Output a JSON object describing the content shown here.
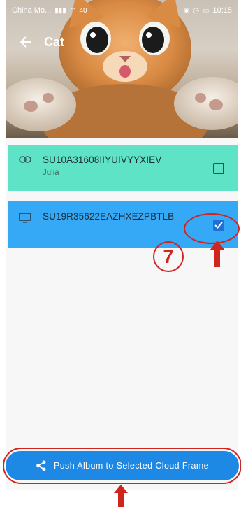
{
  "status_bar": {
    "carrier": "China Mo...",
    "time": "10:15",
    "speed": "40"
  },
  "header": {
    "title": "Cat"
  },
  "devices": [
    {
      "id": "SU10A31608IIYUIVYYXIEV",
      "name": "Julia",
      "icon": "link-icon",
      "checked": false,
      "color": "#5ee3c6"
    },
    {
      "id": "SU19R35622EAZHXEZPBTLB",
      "name": "",
      "icon": "monitor-icon",
      "checked": true,
      "color": "#35a9f6"
    }
  ],
  "annotation": {
    "step_number": "7"
  },
  "push_button": {
    "label": "Push Album to Selected Cloud Frame"
  }
}
